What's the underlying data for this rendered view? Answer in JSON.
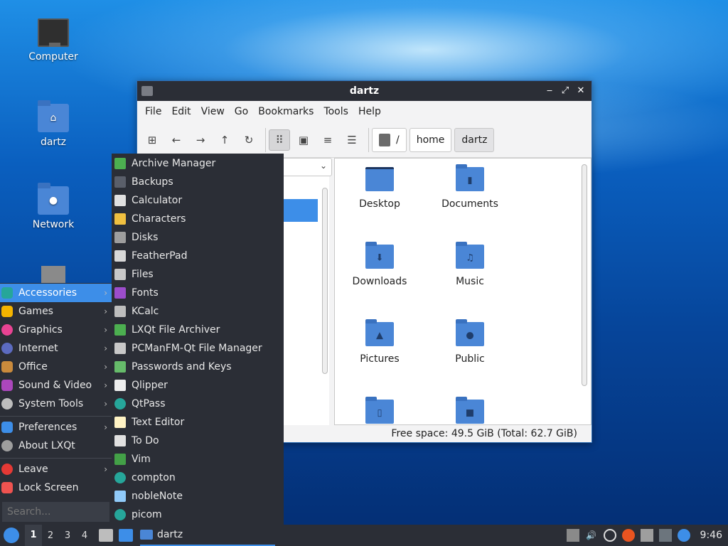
{
  "desktop": {
    "icons": [
      {
        "label": "Computer"
      },
      {
        "label": "dartz"
      },
      {
        "label": "Network"
      }
    ]
  },
  "window": {
    "title": "dartz",
    "menu": [
      "File",
      "Edit",
      "View",
      "Go",
      "Bookmarks",
      "Tools",
      "Help"
    ],
    "breadcrumb": [
      "/",
      "home",
      "dartz"
    ],
    "items": [
      "Desktop",
      "Documents",
      "Downloads",
      "Music",
      "Pictures",
      "Public"
    ],
    "status": "Free space: 49.5 GiB (Total: 62.7 GiB)"
  },
  "start_menu": {
    "categories": [
      "Accessories",
      "Games",
      "Graphics",
      "Internet",
      "Office",
      "Sound & Video",
      "System Tools"
    ],
    "system": [
      "Preferences",
      "About LXQt"
    ],
    "session": [
      "Leave",
      "Lock Screen"
    ],
    "search_placeholder": "Search...",
    "apps": [
      "Archive Manager",
      "Backups",
      "Calculator",
      "Characters",
      "Disks",
      "FeatherPad",
      "Files",
      "Fonts",
      "KCalc",
      "LXQt File Archiver",
      "PCManFM-Qt File Manager",
      "Passwords and Keys",
      "Qlipper",
      "QtPass",
      "Text Editor",
      "To Do",
      "Vim",
      "compton",
      "nobleNote",
      "picom"
    ]
  },
  "taskbar": {
    "desktops": [
      "1",
      "2",
      "3",
      "4"
    ],
    "task_label": "dartz",
    "clock": "9:46"
  },
  "colors": {
    "accent": "#3d8ee8",
    "panel": "#2b2e36",
    "folder": "#4a86d6"
  }
}
